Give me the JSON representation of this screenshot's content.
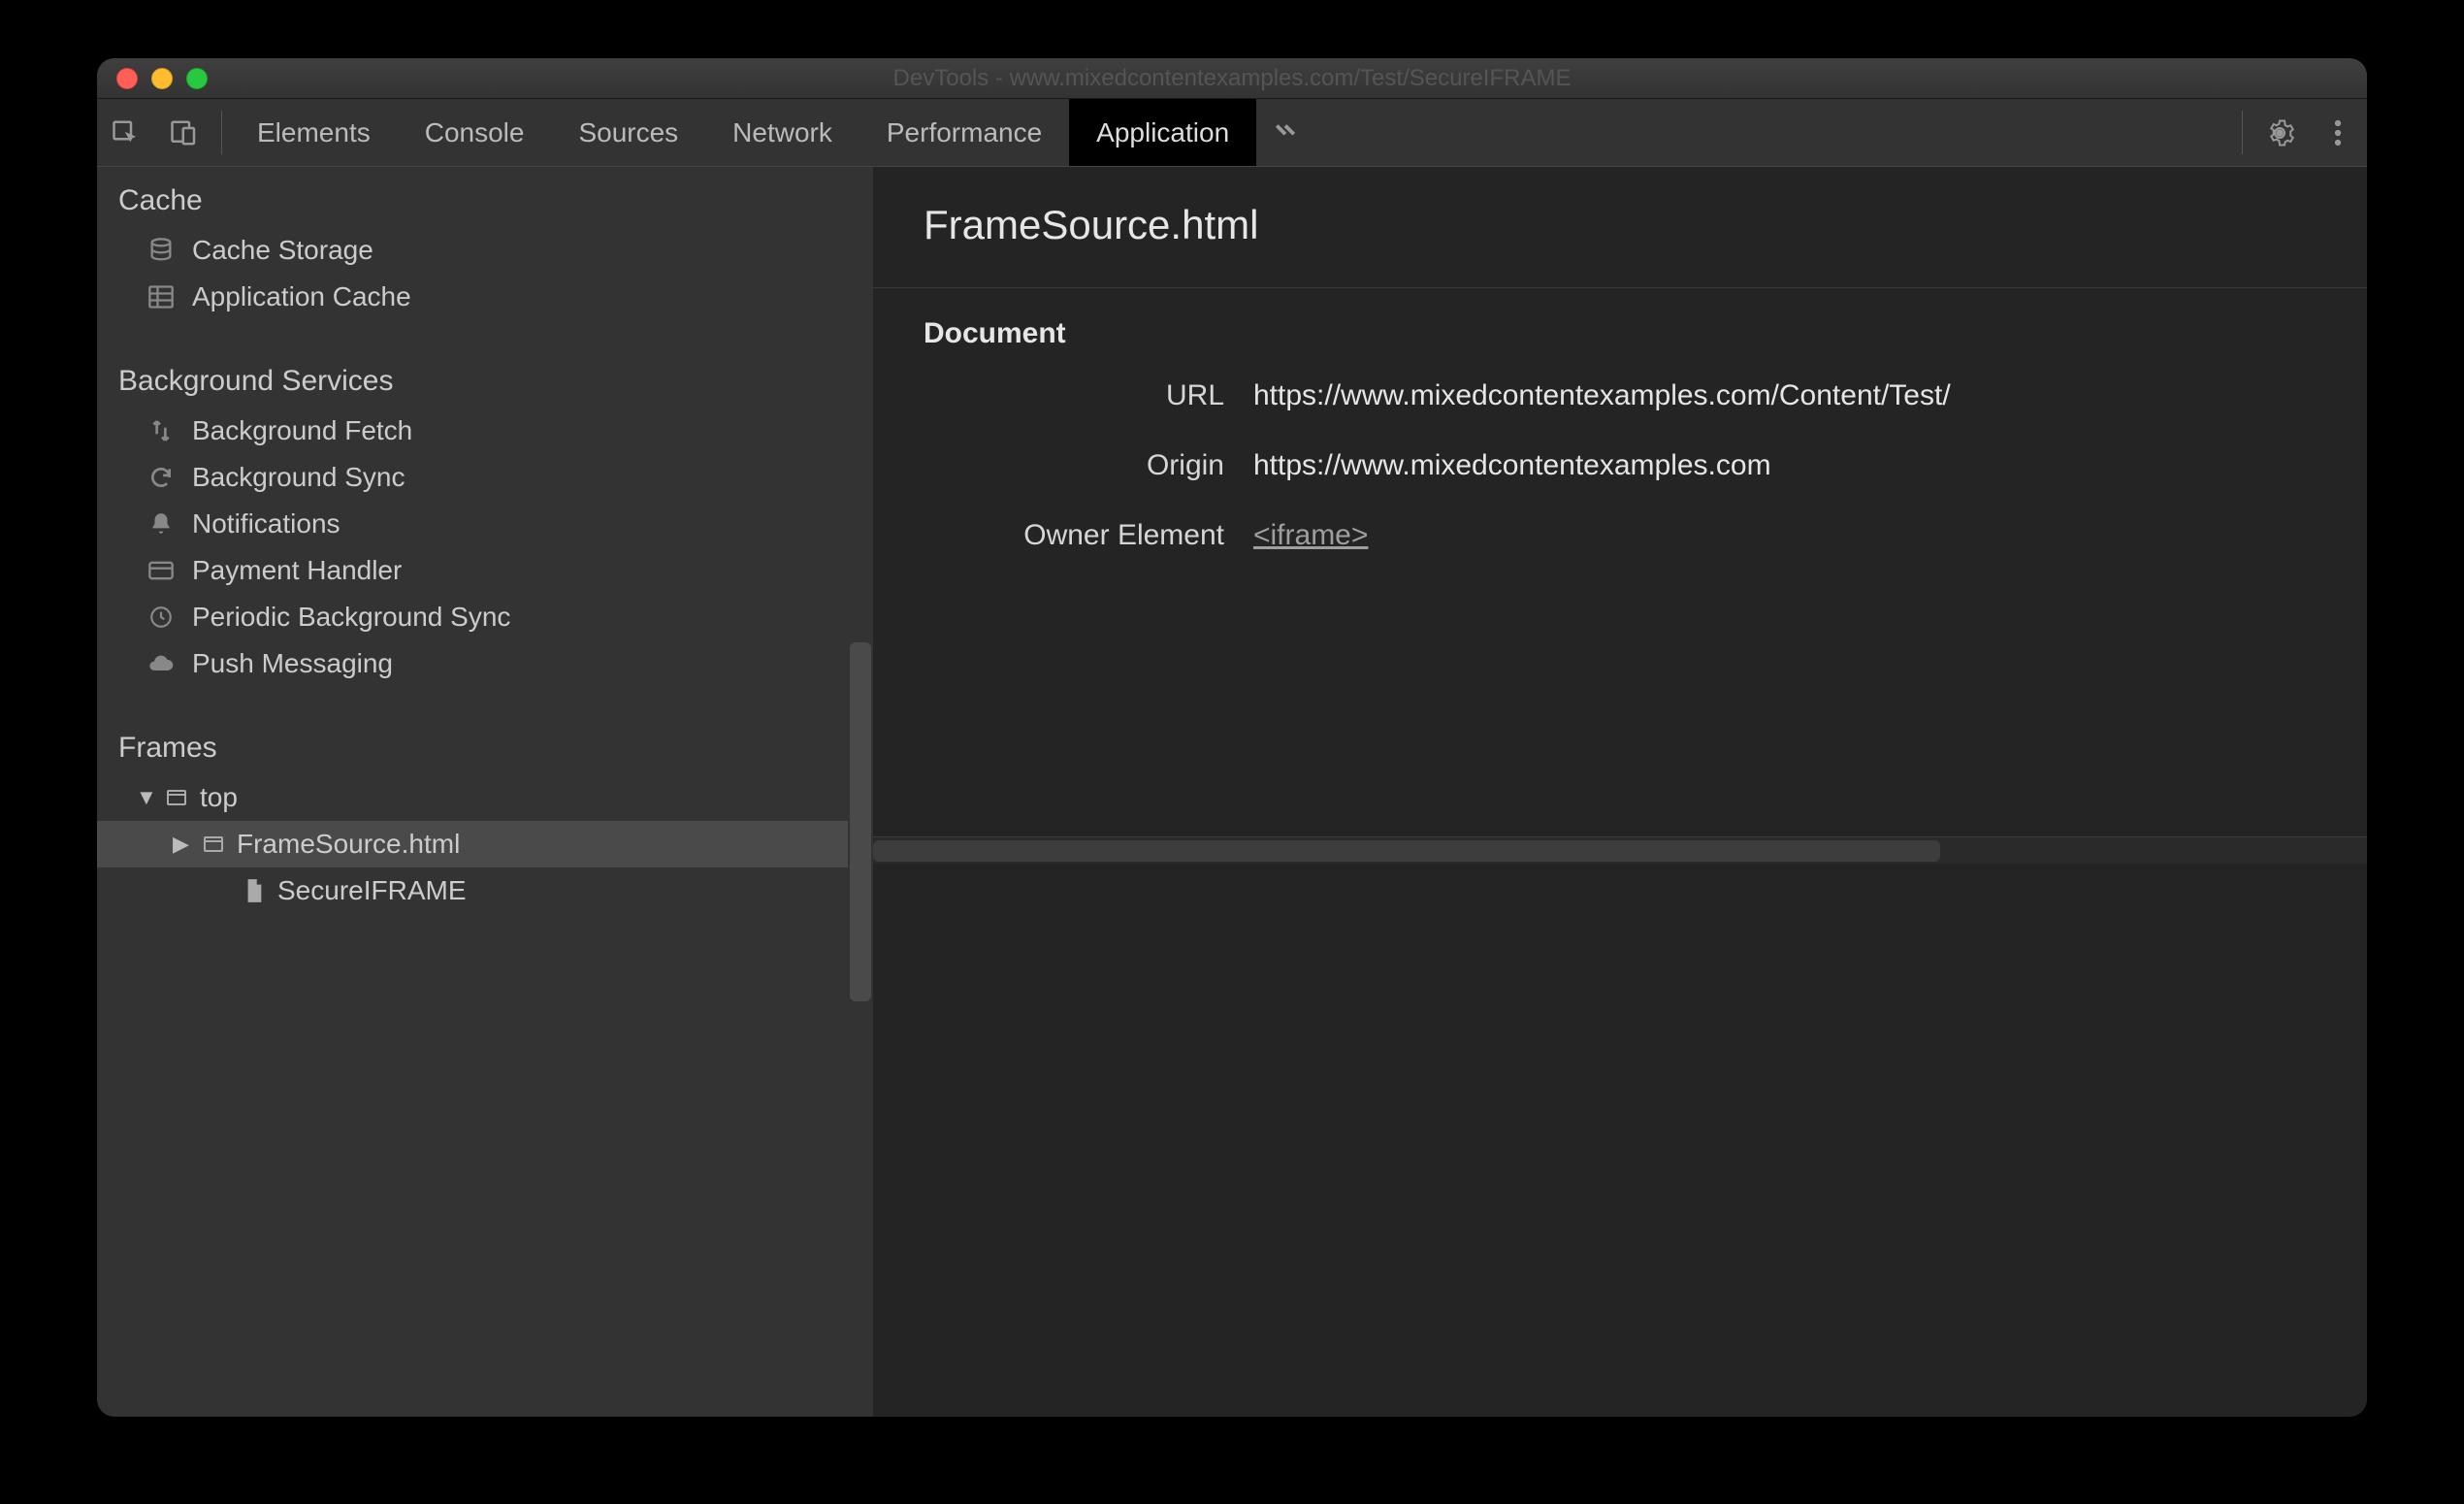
{
  "window": {
    "title": "DevTools - www.mixedcontentexamples.com/Test/SecureIFRAME"
  },
  "tabs": {
    "items": [
      "Elements",
      "Console",
      "Sources",
      "Network",
      "Performance",
      "Application"
    ],
    "active": "Application"
  },
  "sidebar": {
    "sections": {
      "cache": {
        "header": "Cache",
        "items": [
          "Cache Storage",
          "Application Cache"
        ]
      },
      "background_services": {
        "header": "Background Services",
        "items": [
          "Background Fetch",
          "Background Sync",
          "Notifications",
          "Payment Handler",
          "Periodic Background Sync",
          "Push Messaging"
        ]
      },
      "frames": {
        "header": "Frames",
        "tree": {
          "top": {
            "label": "top",
            "expanded": true
          },
          "frame": {
            "label": "FrameSource.html",
            "expanded": false,
            "selected": true
          },
          "doc": {
            "label": "SecureIFRAME"
          }
        }
      }
    }
  },
  "main": {
    "title": "FrameSource.html",
    "section_header": "Document",
    "rows": {
      "url": {
        "key": "URL",
        "value": "https://www.mixedcontentexamples.com/Content/Test/"
      },
      "origin": {
        "key": "Origin",
        "value": "https://www.mixedcontentexamples.com"
      },
      "owner": {
        "key": "Owner Element",
        "value": "<iframe>"
      }
    }
  }
}
